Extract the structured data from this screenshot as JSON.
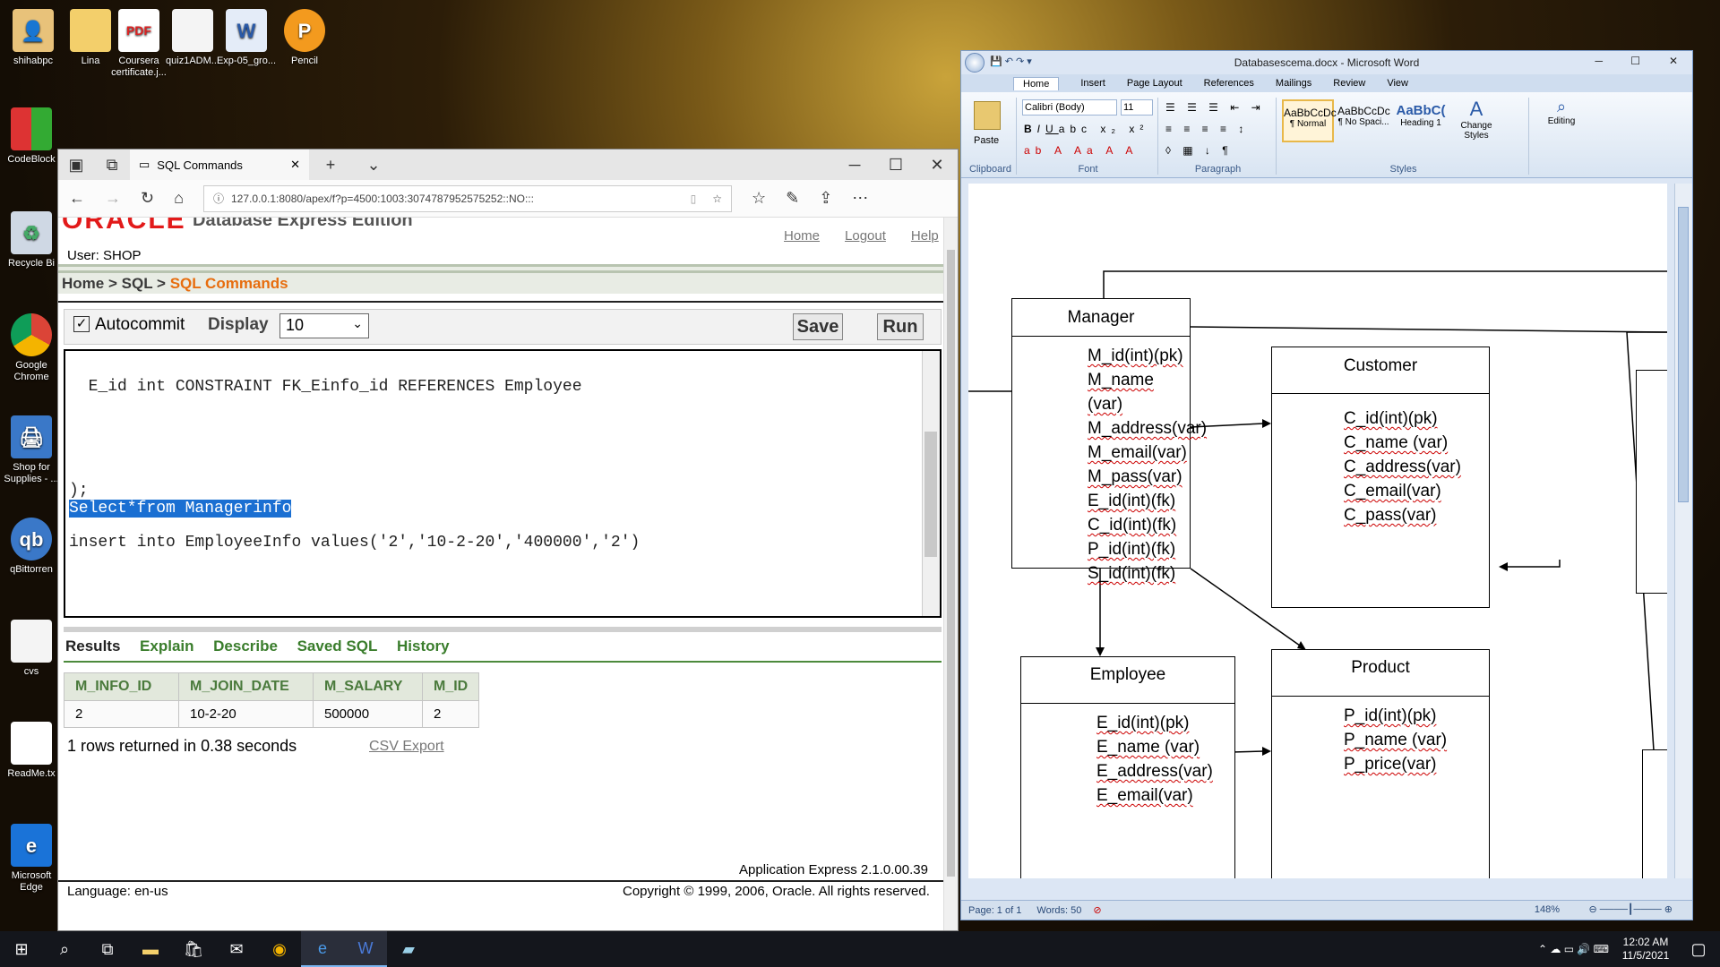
{
  "desktop": {
    "icons_top": [
      {
        "label": "shihabpc"
      },
      {
        "label": "Lina"
      },
      {
        "label": "Coursera certificate.j..."
      },
      {
        "label": "quiz1ADM..."
      },
      {
        "label": "Exp-05_gro..."
      },
      {
        "label": "Pencil"
      }
    ],
    "icons_left": [
      {
        "label": "CodeBlock"
      },
      {
        "label": "Recycle Bi"
      },
      {
        "label": "Google Chrome"
      },
      {
        "label": "Shop for Supplies - ..."
      },
      {
        "label": "qBittorren"
      },
      {
        "label": "cvs"
      },
      {
        "label": "ReadMe.tx"
      },
      {
        "label": "Microsoft Edge"
      }
    ]
  },
  "edge": {
    "tab_title": "SQL Commands",
    "url": "127.0.0.1:8080/apex/f?p=4500:1003:3074787952575252::NO:::",
    "header": {
      "logo": "ORACLE",
      "product": "Database Express Edition",
      "links": [
        "Home",
        "Logout",
        "Help"
      ],
      "user": "User: SHOP"
    },
    "breadcrumb": {
      "home": "Home",
      "sep": ">",
      "sql": "SQL",
      "current": "SQL Commands"
    },
    "controls": {
      "autocommit": "Autocommit",
      "display_label": "Display",
      "display_value": "10",
      "save": "Save",
      "run": "Run"
    },
    "editor": {
      "line1": "  E_id int CONSTRAINT FK_Einfo_id REFERENCES Employee",
      "line2": ");",
      "line3": "Select*from Managerinfo",
      "line4": "insert into EmployeeInfo values('2','10-2-20','400000','2')"
    },
    "result_tabs": [
      "Results",
      "Explain",
      "Describe",
      "Saved SQL",
      "History"
    ],
    "table": {
      "headers": [
        "M_INFO_ID",
        "M_JOIN_DATE",
        "M_SALARY",
        "M_ID"
      ],
      "rows": [
        [
          "2",
          "10-2-20",
          "500000",
          "2"
        ]
      ]
    },
    "rows_returned": "1 rows returned in 0.38 seconds",
    "csv_export": "CSV Export",
    "app_version": "Application Express 2.1.0.00.39",
    "language": "Language: en-us",
    "copyright": "Copyright © 1999, 2006, Oracle. All rights reserved."
  },
  "word": {
    "title": "Databasescema.docx - Microsoft Word",
    "tabs": [
      "Home",
      "Insert",
      "Page Layout",
      "References",
      "Mailings",
      "Review",
      "View"
    ],
    "font": "Calibri (Body)",
    "font_size": "11",
    "styles": [
      {
        "preview": "AaBbCcDc",
        "name": "¶ Normal"
      },
      {
        "preview": "AaBbCcDc",
        "name": "¶ No Spaci..."
      },
      {
        "preview": "AaBbC(",
        "name": "Heading 1"
      }
    ],
    "change_styles": "Change Styles",
    "editing": "Editing",
    "paste": "Paste",
    "groups": [
      "Clipboard",
      "Font",
      "Paragraph",
      "Styles"
    ],
    "entities": {
      "manager": {
        "title": "Manager",
        "fields": [
          "M_id(int)(pk)",
          "M_name (var)",
          "M_address(var)",
          "M_email(var)",
          "M_pass(var)",
          "E_id(int)(fk)",
          "C_id(int)(fk)",
          "P_id(int)(fk)",
          "S_id(int)(fk)"
        ]
      },
      "customer": {
        "title": "Customer",
        "fields": [
          "C_id(int)(pk)",
          "C_name (var)",
          "C_address(var)",
          "C_email(var)",
          "C_pass(var)"
        ]
      },
      "employee": {
        "title": "Employee",
        "fields": [
          "E_id(int)(pk)",
          "E_name (var)",
          "E_address(var)",
          "E_email(var)"
        ]
      },
      "product": {
        "title": "Product",
        "fields": [
          "P_id(int)(pk)",
          "P_name (var)",
          "P_price(var)"
        ]
      }
    },
    "status": {
      "page": "Page: 1 of 1",
      "words": "Words: 50",
      "zoom": "148%"
    }
  },
  "taskbar": {
    "time": "12:02 AM",
    "date": "11/5/2021"
  }
}
